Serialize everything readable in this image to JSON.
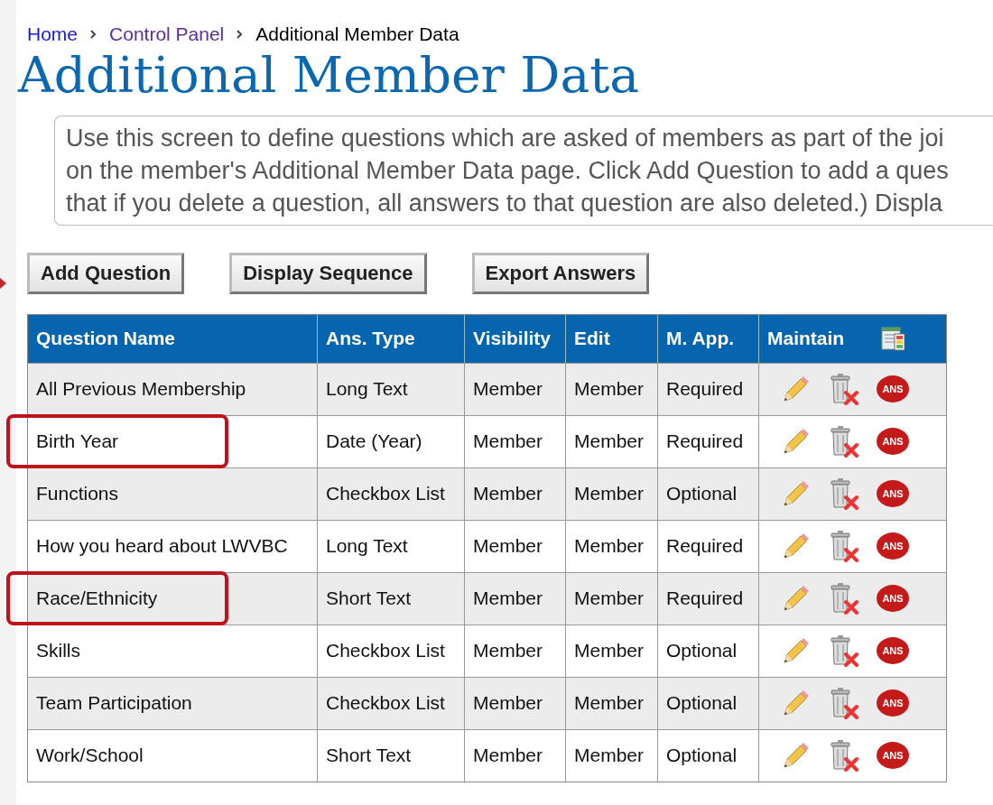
{
  "breadcrumb": [
    {
      "label": "Home",
      "kind": "link",
      "visited": false
    },
    {
      "label": "Control Panel",
      "kind": "link",
      "visited": true
    },
    {
      "label": "Additional Member Data",
      "kind": "current"
    }
  ],
  "title": "Additional Member Data",
  "description": [
    "Use this screen to define questions which are asked of members as part of the joi",
    "on the member's Additional Member Data page. Click Add Question to add a ques",
    "that if you delete a question, all answers to that question are also deleted.) Displa"
  ],
  "buttons": [
    "Add Question",
    "Display Sequence",
    "Export Answers"
  ],
  "table": {
    "columns": [
      "Question Name",
      "Ans. Type",
      "Visibility",
      "Edit",
      "M. App.",
      "Maintain"
    ],
    "rows": [
      {
        "cells": [
          "All Previous Membership",
          "Long Text",
          "Member",
          "Member",
          "Required"
        ],
        "highlighted": false,
        "answers_badge": "ANS"
      },
      {
        "cells": [
          "Birth Year",
          "Date (Year)",
          "Member",
          "Member",
          "Required"
        ],
        "highlighted": true,
        "answers_badge": "ANS"
      },
      {
        "cells": [
          "Functions",
          "Checkbox List",
          "Member",
          "Member",
          "Optional"
        ],
        "highlighted": false,
        "answers_badge": "ANS"
      },
      {
        "cells": [
          "How you heard about LWVBC",
          "Long Text",
          "Member",
          "Member",
          "Required"
        ],
        "highlighted": false,
        "answers_badge": "ANS"
      },
      {
        "cells": [
          "Race/Ethnicity",
          "Short Text",
          "Member",
          "Member",
          "Required"
        ],
        "highlighted": true,
        "answers_badge": "ANS"
      },
      {
        "cells": [
          "Skills",
          "Checkbox List",
          "Member",
          "Member",
          "Optional"
        ],
        "highlighted": false,
        "answers_badge": "ANS"
      },
      {
        "cells": [
          "Team Participation",
          "Checkbox List",
          "Member",
          "Member",
          "Optional"
        ],
        "highlighted": false,
        "answers_badge": "ANS"
      },
      {
        "cells": [
          "Work/School",
          "Short Text",
          "Member",
          "Member",
          "Optional"
        ],
        "highlighted": false,
        "answers_badge": "ANS"
      }
    ]
  }
}
